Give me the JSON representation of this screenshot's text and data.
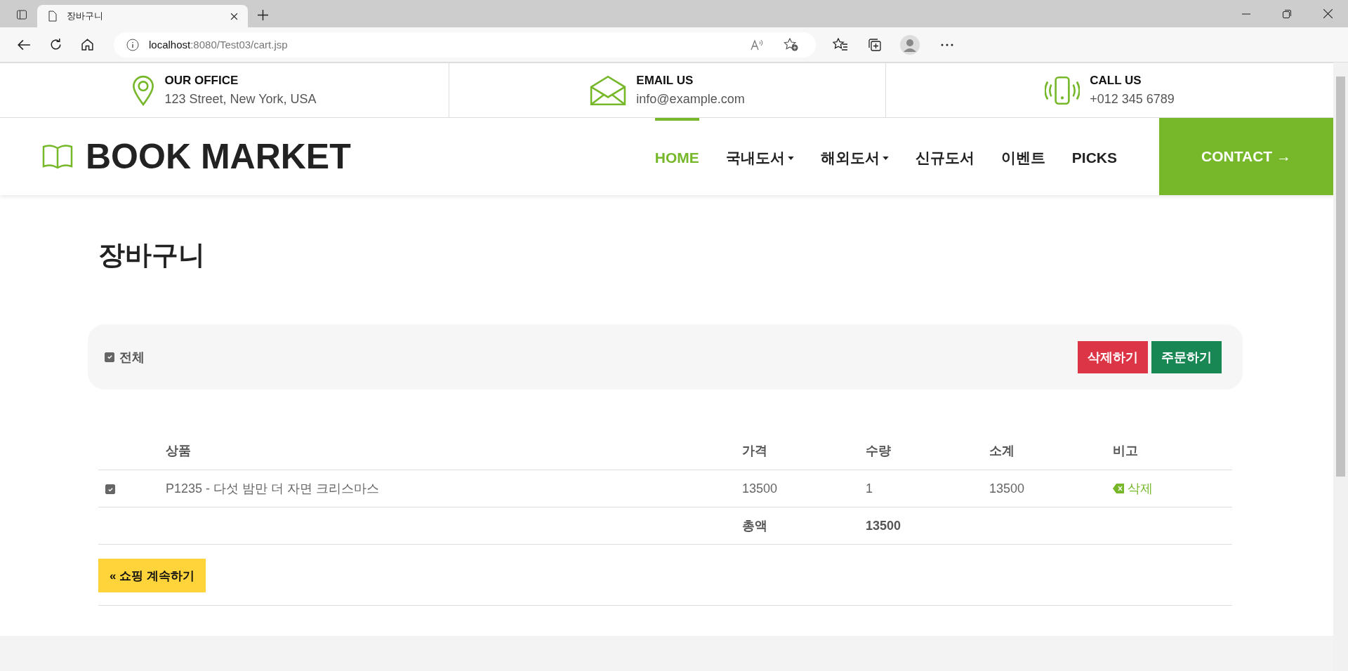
{
  "browser": {
    "tab_title": "장바구니",
    "url_host": "localhost",
    "url_path": ":8080/Test03/cart.jsp"
  },
  "topbar": [
    {
      "kind": "pin",
      "title": "OUR OFFICE",
      "value": "123 Street, New York, USA"
    },
    {
      "kind": "mail",
      "title": "EMAIL US",
      "value": "info@example.com"
    },
    {
      "kind": "phone",
      "title": "CALL US",
      "value": "+012 345 6789"
    }
  ],
  "brand": "BOOK MARKET",
  "nav": [
    {
      "label": "HOME",
      "selected": true,
      "dropdown": false
    },
    {
      "label": "국내도서",
      "selected": false,
      "dropdown": true
    },
    {
      "label": "해외도서",
      "selected": false,
      "dropdown": true
    },
    {
      "label": "신규도서",
      "selected": false,
      "dropdown": false
    },
    {
      "label": "이벤트",
      "selected": false,
      "dropdown": false
    },
    {
      "label": "PICKS",
      "selected": false,
      "dropdown": false
    }
  ],
  "contact_button": "CONTACT →",
  "page_title": "장바구니",
  "toolbar": {
    "select_all": {
      "label": "전체",
      "checked": true
    },
    "buttons": [
      {
        "kind": "danger",
        "label": "삭제하기"
      },
      {
        "kind": "success",
        "label": "주문하기"
      }
    ]
  },
  "table": {
    "columns": [
      "상품",
      "가격",
      "수량",
      "소계",
      "비고"
    ],
    "rows": [
      {
        "checked": true,
        "product": "P1235 - 다섯 밤만 더 자면 크리스마스",
        "price": "13500",
        "quantity": "1",
        "subtotal": "13500",
        "action": "삭제"
      }
    ],
    "total_label": "총액",
    "total": "13500"
  },
  "continue_button": "« 쇼핑 계속하기"
}
